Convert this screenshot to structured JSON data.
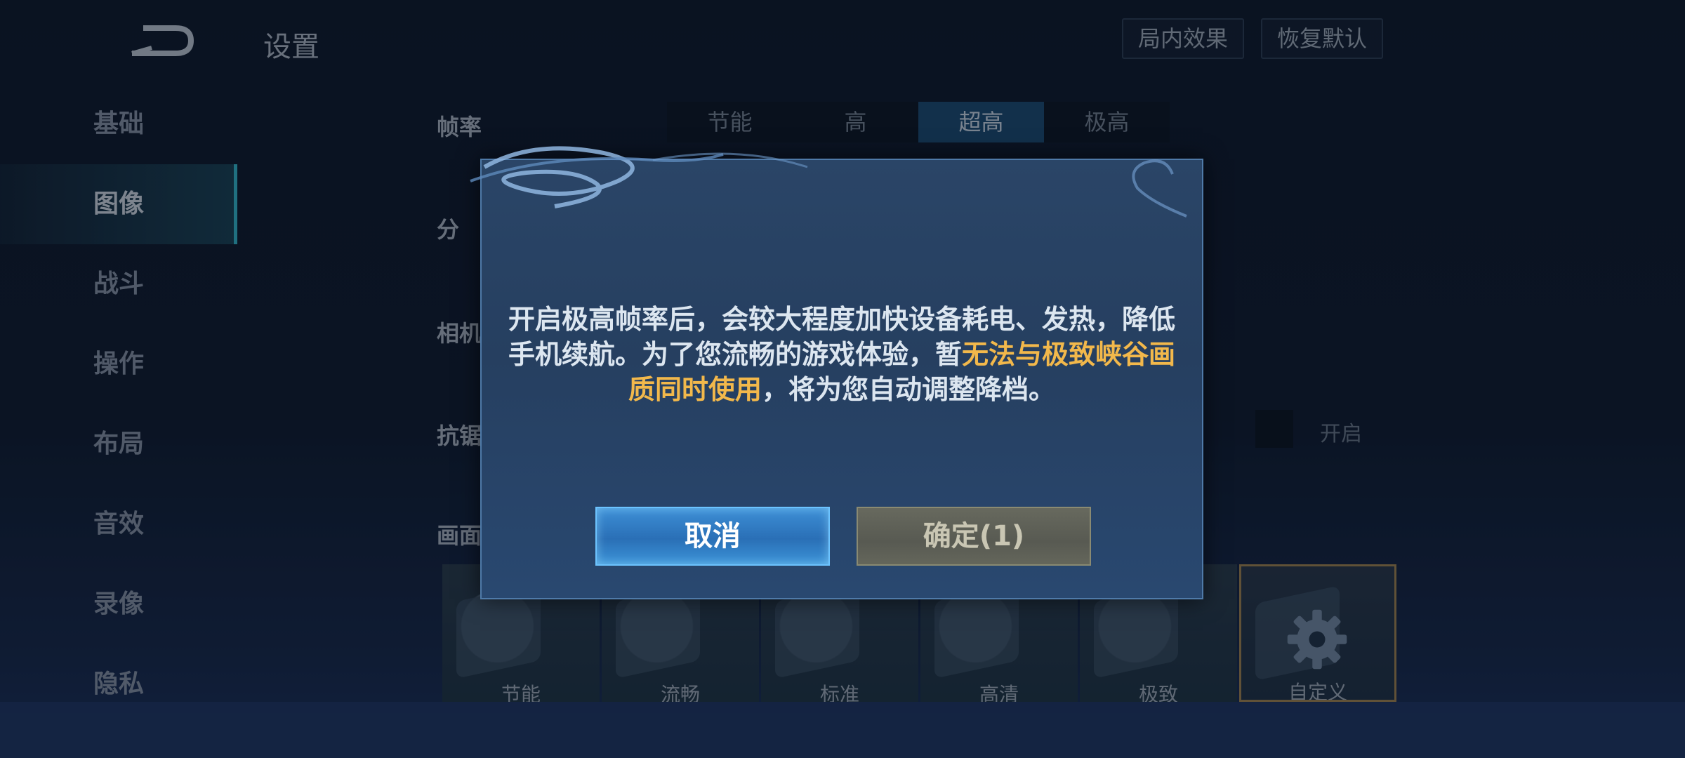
{
  "header": {
    "title": "设置",
    "buttons": {
      "in_game_effects": "局内效果",
      "restore_default": "恢复默认"
    }
  },
  "sidebar": {
    "items": [
      {
        "label": "基础"
      },
      {
        "label": "图像",
        "active": true
      },
      {
        "label": "战斗"
      },
      {
        "label": "操作"
      },
      {
        "label": "布局"
      },
      {
        "label": "音效"
      },
      {
        "label": "录像"
      },
      {
        "label": "隐私"
      }
    ]
  },
  "settings": {
    "frame_rate": {
      "label": "帧率",
      "options": [
        "节能",
        "高",
        "超高",
        "极高"
      ],
      "selected": "超高"
    },
    "row2_label": "分",
    "camera_label": "相机",
    "antialias_label": "抗锯",
    "antialias_toggle_text": "开启",
    "graphics_label": "画面",
    "presets": [
      "节能",
      "流畅",
      "标准",
      "高清",
      "极致",
      "自定义"
    ]
  },
  "dialog": {
    "message_part1": "开启极高帧率后，会较大程度加快设备耗电、发热，降低手机续航。为了您流畅的游戏体验，暂",
    "message_highlight": "无法与极致峡谷画质同时使用",
    "message_part2": "，将为您自动调整降档。",
    "cancel_label": "取消",
    "confirm_label": "确定(1)",
    "highlight_color": "#f2b84b"
  }
}
